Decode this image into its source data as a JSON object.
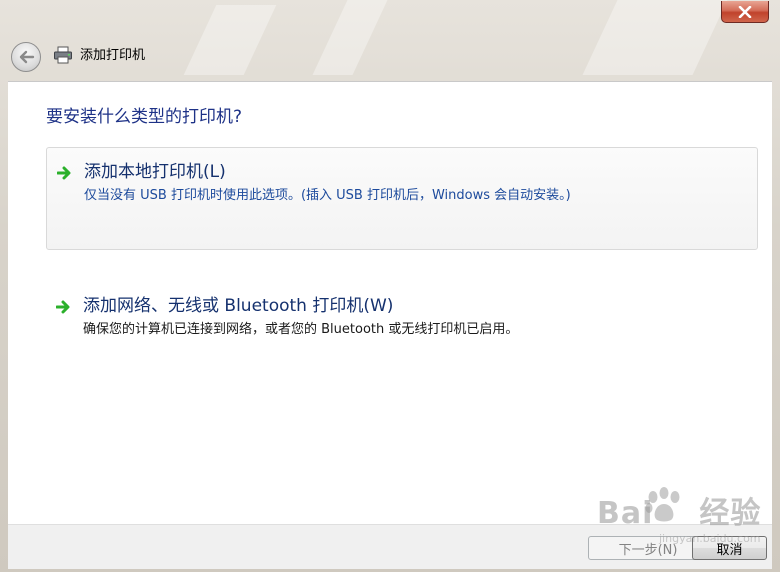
{
  "window": {
    "title": "添加打印机",
    "close_label": "关闭"
  },
  "page": {
    "heading": "要安装什么类型的打印机?"
  },
  "options": [
    {
      "title": "添加本地打印机(L)",
      "description": "仅当没有 USB 打印机时使用此选项。(插入 USB 打印机后，Windows 会自动安装。)"
    },
    {
      "title": "添加网络、无线或 Bluetooth 打印机(W)",
      "description": "确保您的计算机已连接到网络，或者您的 Bluetooth 或无线打印机已启用。"
    }
  ],
  "footer": {
    "next_label": "下一步(N)",
    "cancel_label": "取消"
  },
  "watermark": {
    "brand": "Bai",
    "brand_tail": "经验",
    "url": "jingyan.baidu.com"
  },
  "colors": {
    "heading": "#1e3287",
    "link_desc": "#1c4a9c",
    "arrow_green": "#2bb02b",
    "close_red": "#c0432c"
  },
  "icons": {
    "back": "back-arrow-icon",
    "printer": "printer-icon",
    "option_arrow": "green-arrow-icon",
    "close": "close-icon"
  }
}
